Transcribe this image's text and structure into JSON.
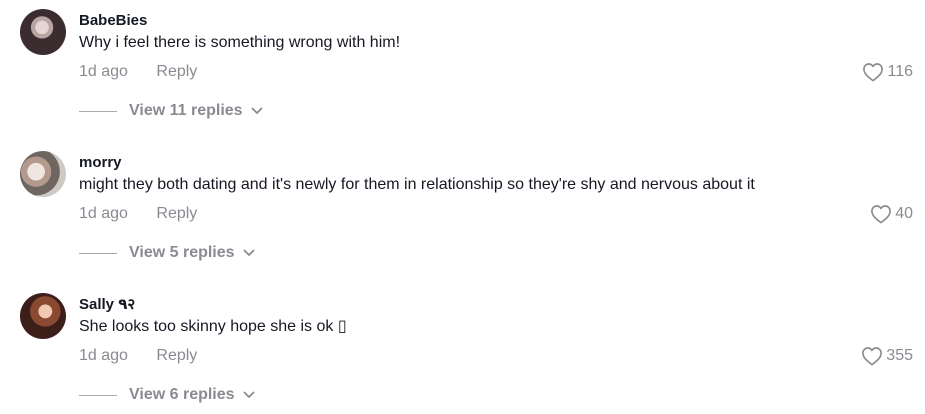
{
  "comments": [
    {
      "username": "BabeBies",
      "text": "Why i feel there is something wrong with him!",
      "time": "1d ago",
      "reply_label": "Reply",
      "likes": "116",
      "view_replies": "View 11 replies"
    },
    {
      "username": "morry",
      "text": "might they both dating and it's newly for them in relationship so they're shy and nervous about it",
      "time": "1d ago",
      "reply_label": "Reply",
      "likes": "40",
      "view_replies": "View 5 replies"
    },
    {
      "username": "Sally ٩२",
      "text": "She looks too skinny hope she is ok ▯",
      "time": "1d ago",
      "reply_label": "Reply",
      "likes": "355",
      "view_replies": "View 6 replies"
    }
  ],
  "icons": {
    "like": "heart-outline-icon",
    "expand": "chevron-down-icon"
  },
  "colors": {
    "primary_text": "#161823",
    "secondary_text": "#8a8b91",
    "divider": "#a8a9ad"
  }
}
